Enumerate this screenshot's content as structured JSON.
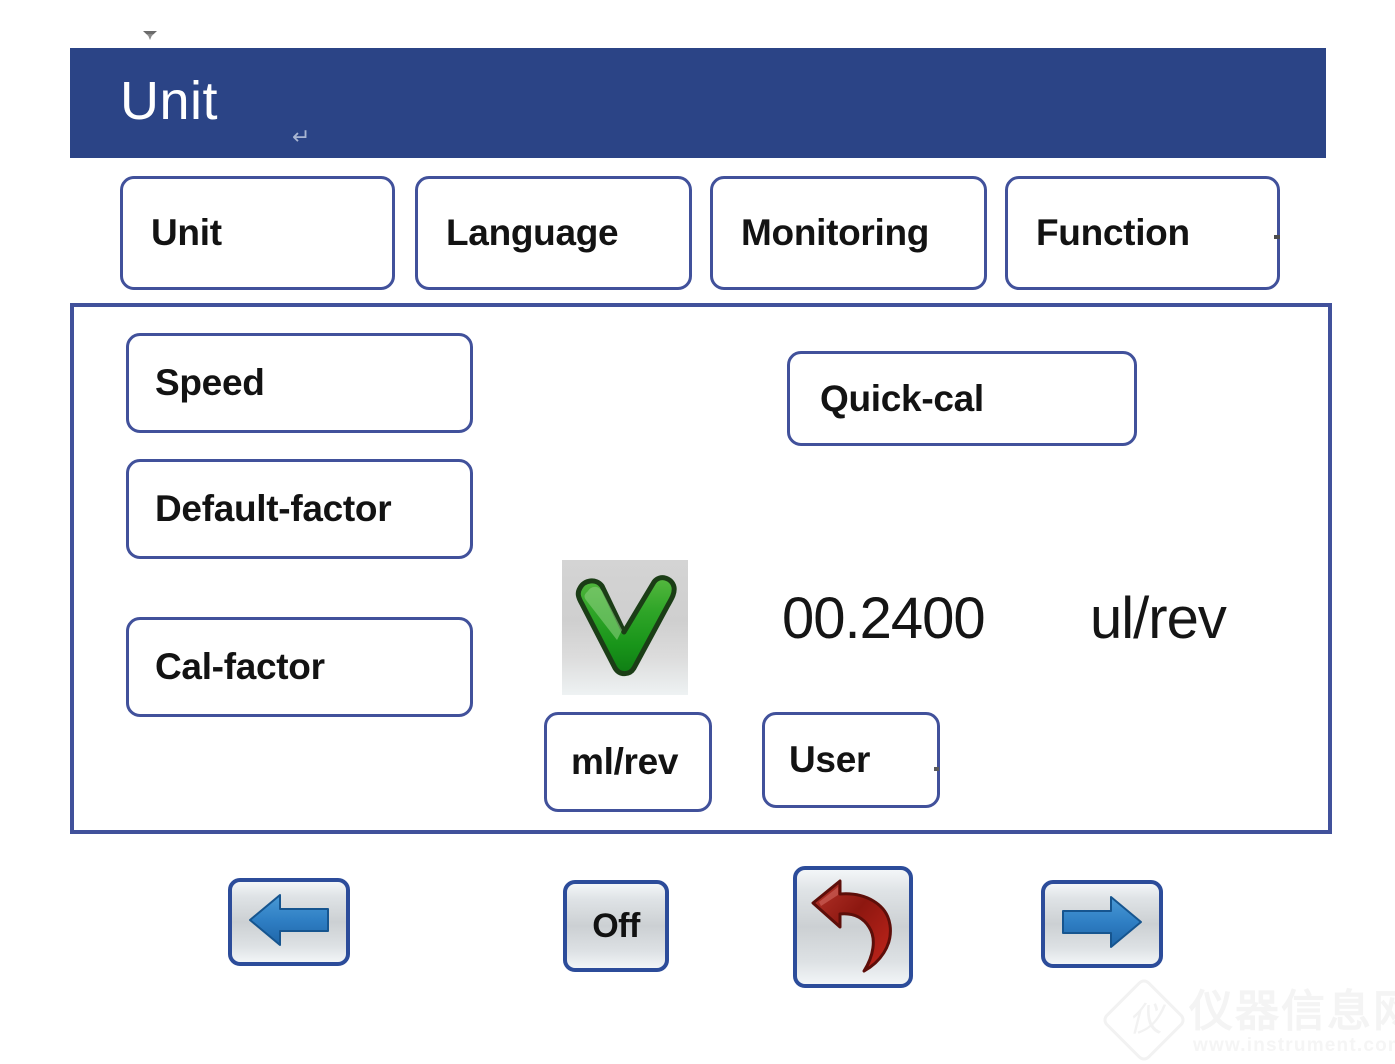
{
  "header": {
    "title": "Unit",
    "pilcrow": "↵",
    "bg_color": "#2b4486"
  },
  "tabs": [
    {
      "label": "Unit",
      "selected": true
    },
    {
      "label": "Language",
      "selected": false
    },
    {
      "label": "Monitoring",
      "selected": false
    },
    {
      "label": "Function",
      "selected": false
    }
  ],
  "panel": {
    "left_options": [
      {
        "label": "Speed"
      },
      {
        "label": "Default-factor"
      },
      {
        "label": "Cal-factor"
      }
    ],
    "quick_cal": {
      "label": "Quick-cal"
    },
    "status_icon": "green-check-icon",
    "value": "00.2400",
    "unit": "ul/rev",
    "unit_buttons": [
      {
        "label": "ml/rev"
      },
      {
        "label": "User"
      }
    ]
  },
  "toolbar": {
    "prev": {
      "icon": "arrow-left-icon"
    },
    "off": {
      "label": "Off"
    },
    "undo": {
      "icon": "undo-arrow-icon"
    },
    "next": {
      "icon": "arrow-right-icon"
    }
  },
  "watermark": {
    "logo_text": "仪",
    "cn_text": "仪器信息网",
    "url_text": "www.instrument.com.cn"
  },
  "colors": {
    "header_blue": "#2b4486",
    "border_blue": "#41519b",
    "icon_blue": "#2f7fc4",
    "check_green": "#2da522",
    "undo_red": "#9e1f17"
  }
}
